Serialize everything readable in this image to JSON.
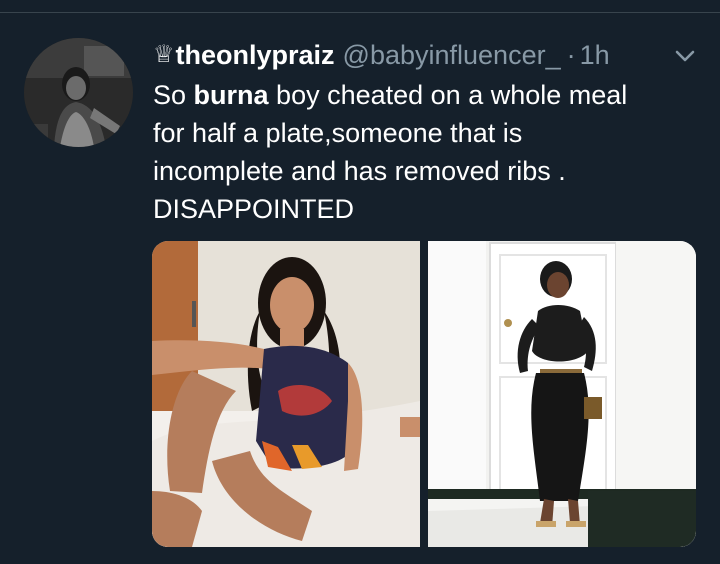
{
  "tweet": {
    "author": {
      "crown_glyph": "♕",
      "display_name": "theonlypraiz",
      "handle": "@babyinfluencer_",
      "separator": "·",
      "time": "1h"
    },
    "text": {
      "line1_prefix": "So ",
      "line1_bold": "burna",
      "line1_suffix": " boy cheated on a whole meal",
      "line2": "for half a plate,someone that is",
      "line3": "incomplete and has removed ribs .",
      "line4": "DISAPPOINTED"
    },
    "media": [
      {
        "name": "photo-woman-on-bed"
      },
      {
        "name": "photo-woman-black-dress"
      }
    ],
    "icons": {
      "avatar": "avatar",
      "menu": "chevron-down-icon",
      "badge": "crown-icon"
    },
    "colors": {
      "background": "#15202b",
      "text": "#ffffff",
      "secondary_text": "#8899a6",
      "divider": "#38444d"
    }
  }
}
